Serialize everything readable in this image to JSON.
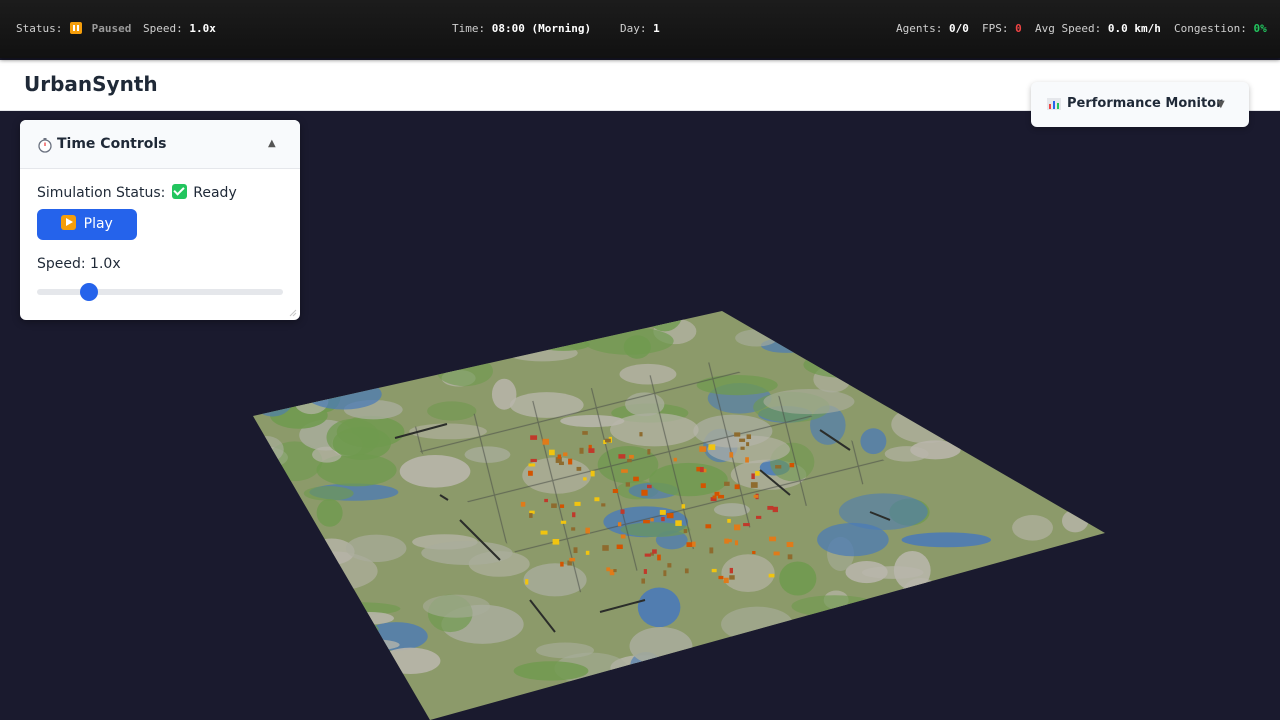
{
  "statusbar": {
    "status_label": "Status:",
    "status_value": "Paused",
    "speed_label": "Speed:",
    "speed_value": "1.0x",
    "time_label": "Time:",
    "time_value": "08:00 (Morning)",
    "day_label": "Day:",
    "day_value": "1",
    "agents_label": "Agents:",
    "agents_value": "0/0",
    "fps_label": "FPS:",
    "fps_value": "0",
    "avgspeed_label": "Avg Speed:",
    "avgspeed_value": "0.0 km/h",
    "congestion_label": "Congestion:",
    "congestion_value": "0%"
  },
  "header": {
    "title": "UrbanSynth"
  },
  "performance_monitor": {
    "title": "Performance Monitor",
    "icon": "bar-chart-icon",
    "expanded": false
  },
  "time_controls": {
    "title": "Time Controls",
    "icon": "stopwatch-icon",
    "status_label": "Simulation Status:",
    "status_value": "Ready",
    "play_label": "Play",
    "speed_label": "Speed: 1.0x",
    "speed_slider_level": 0.21
  },
  "colors": {
    "accent": "#2563eb",
    "paused": "#f59e0b",
    "ready": "#22c55e",
    "fps": "#ef4444",
    "congestion": "#22c55e",
    "background": "#1a1a2e"
  }
}
